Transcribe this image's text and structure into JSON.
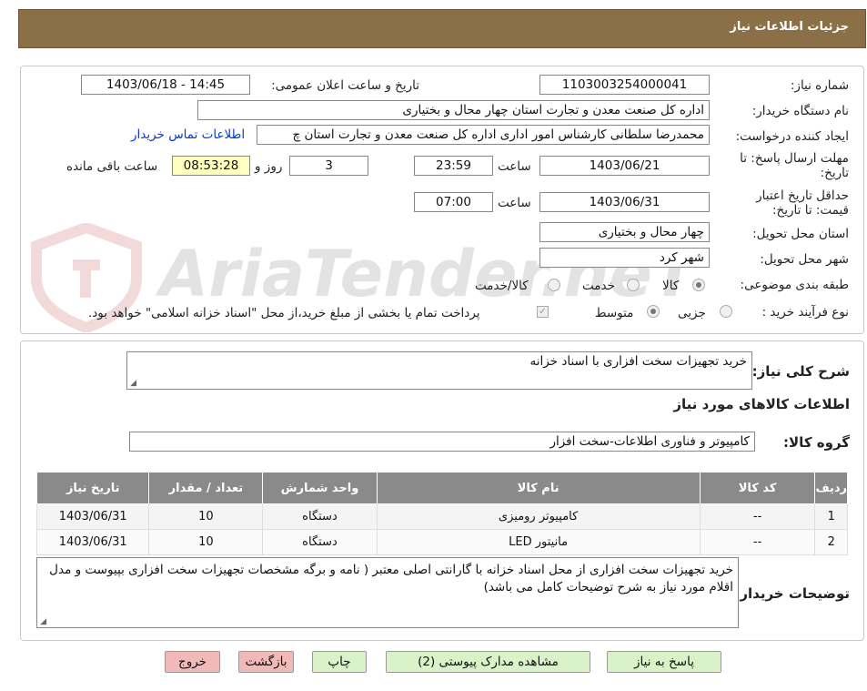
{
  "header": {
    "title": "جزئیات اطلاعات نیاز"
  },
  "form": {
    "need_number_label": "شماره نیاز:",
    "need_number": "1103003254000041",
    "announce_label": "تاریخ و ساعت اعلان عمومی:",
    "announce_value": "1403/06/18 - 14:45",
    "buyer_org_label": "نام دستگاه خریدار:",
    "buyer_org": "اداره کل صنعت  معدن و تجارت استان چهار محال و بختیاری",
    "creator_label": "ایجاد کننده درخواست:",
    "creator": "محمدرضا سلطانی کارشناس امور اداری اداره کل صنعت  معدن و تجارت استان چ",
    "contact_link": "اطلاعات تماس خریدار",
    "deadline_label": "مهلت ارسال پاسخ: تا تاریخ:",
    "deadline_date": "1403/06/21",
    "time_label": "ساعت",
    "deadline_time": "23:59",
    "days_value": "3",
    "days_label": "روز و",
    "remaining_time": "08:53:28",
    "remaining_label": "ساعت باقی مانده",
    "validity_label": "حداقل تاریخ اعتبار قیمت: تا تاریخ:",
    "validity_date": "1403/06/31",
    "validity_time": "07:00",
    "province_label": "استان محل تحویل:",
    "province": "چهار محال و بختیاری",
    "city_label": "شهر محل تحویل:",
    "city": "شهر کرد",
    "category_label": "طبقه بندی موضوعی:",
    "category_options": [
      "کالا",
      "خدمت",
      "کالا/خدمت"
    ],
    "process_label": "نوع فرآیند خرید :",
    "process_options": [
      "جزیی",
      "متوسط"
    ],
    "payment_note": "پرداخت تمام یا بخشی از مبلغ خرید،از محل \"اسناد خزانه اسلامی\" خواهد بود."
  },
  "watermark": {
    "text": "AriaTender.neT"
  },
  "summary": {
    "label": "شرح کلی نیاز:",
    "value": "خرید تجهیزات سخت افزاری با اسناد خزانه",
    "goods_section_title": "اطلاعات کالاهای مورد نیاز",
    "group_label": "گروه کالا:",
    "group_value": "کامپیوتر و فناوری اطلاعات-سخت افزار"
  },
  "table": {
    "columns": [
      "ردیف",
      "کد کالا",
      "نام کالا",
      "واحد شمارش",
      "تعداد / مقدار",
      "تاریخ نیاز"
    ],
    "rows": [
      [
        "1",
        "--",
        "کامپیوتر رومیزی",
        "دستگاه",
        "10",
        "1403/06/31"
      ],
      [
        "2",
        "--",
        "مانیتور LED",
        "دستگاه",
        "10",
        "1403/06/31"
      ]
    ]
  },
  "notes": {
    "label": "توضیحات خریدار:",
    "value": "خرید تجهیزات سخت افزاری از محل اسناد خزانه با  گارانتی اصلی معتبر (  نامه  و برگه مشخصات تجهیزات سخت افزاری بپیوست و مدل اقلام مورد نیاز به شرح توضیحات کامل می باشد)"
  },
  "buttons": {
    "respond": "پاسخ به نیاز",
    "attachments": "مشاهده مدارک پیوستی (2)",
    "print": "چاپ",
    "back": "بازگشت",
    "exit": "خروج"
  }
}
